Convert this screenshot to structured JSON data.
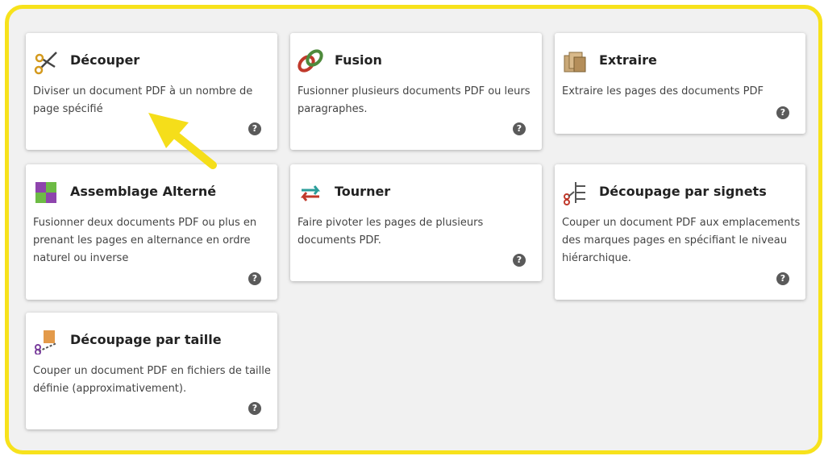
{
  "tools": [
    {
      "title": "Découper",
      "desc": "Diviser un document PDF à un nombre de page spécifié",
      "icon": "scissors-icon",
      "help": "?"
    },
    {
      "title": "Fusion",
      "desc": "Fusionner plusieurs documents PDF ou leurs paragraphes.",
      "icon": "chain-link-icon",
      "help": "?"
    },
    {
      "title": "Extraire",
      "desc": "Extraire les pages des documents PDF",
      "icon": "pages-stack-icon",
      "help": "?"
    },
    {
      "title": "Assemblage Alterné",
      "desc": "Fusionner deux documents PDF ou plus en prenant les pages en alternance en ordre naturel ou inverse",
      "icon": "alternate-tiles-icon",
      "help": "?"
    },
    {
      "title": "Tourner",
      "desc": "Faire pivoter les pages de plusieurs documents PDF.",
      "icon": "rotate-arrows-icon",
      "help": "?"
    },
    {
      "title": "Découpage par signets",
      "desc": "Couper un document PDF aux emplacements des marques pages en spécifiant le niveau hiérarchique.",
      "icon": "bookmark-split-icon",
      "help": "?"
    },
    {
      "title": "Découpage par taille",
      "desc": "Couper un document PDF en fichiers de taille définie (approximativement).",
      "icon": "size-split-icon",
      "help": "?"
    }
  ],
  "colors": {
    "frame_border": "#f7e21c",
    "arrow": "#f5de1a",
    "background": "#f1f1f1"
  }
}
